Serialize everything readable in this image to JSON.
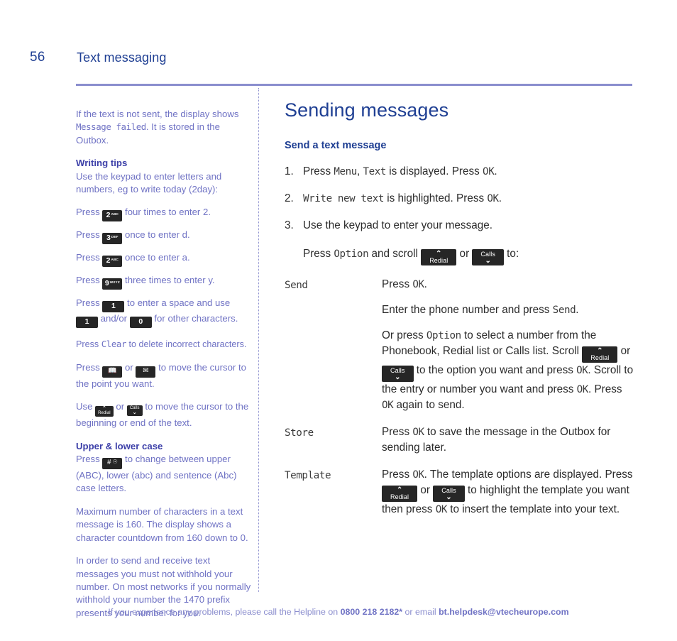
{
  "header": {
    "page_number": "56",
    "chapter_title": "Text messaging"
  },
  "left_column": {
    "intro": {
      "part1": "If the text is not sent, the display shows ",
      "lcd": "Message failed",
      "part2": ". It is stored in the Outbox."
    },
    "writing_tips": {
      "heading": "Writing tips",
      "lead": "Use the keypad to enter letters and numbers, eg to write today (2day):",
      "steps": [
        {
          "before": "Press ",
          "key": {
            "digit": "2",
            "letters": "ABC"
          },
          "after": " four times to enter 2."
        },
        {
          "before": "Press ",
          "key": {
            "digit": "3",
            "letters": "DEF"
          },
          "after": " once to enter d."
        },
        {
          "before": "Press ",
          "key": {
            "digit": "2",
            "letters": "ABC"
          },
          "after": " once to enter a."
        },
        {
          "before": "Press ",
          "key": {
            "digit": "9",
            "letters": "WXYZ"
          },
          "after": " three times to enter y."
        }
      ],
      "space_line": {
        "part1": "Press ",
        "key1": "1",
        "part2": " to enter a space and use ",
        "key2": "1",
        "part3": " and/or ",
        "key3": "0",
        "part4": " for other characters."
      },
      "clear_line": {
        "part1": "Press ",
        "lcd": "Clear",
        "part2": " to delete incorrect characters."
      },
      "cursor_line": {
        "part1": "Press ",
        "key_book": "book-key",
        "part2": " or ",
        "key_envelope": "envelope-key",
        "part3": " to move the cursor to the point you want."
      },
      "ends_line": {
        "part1": "Use ",
        "key_redial": {
          "arrow": "⌃",
          "label": "Redial"
        },
        "part2": " or ",
        "key_calls": {
          "arrow": "⌄",
          "label": "Calls"
        },
        "part3": " to move the cursor to the beginning or end of the text."
      }
    },
    "upper_lower": {
      "heading": "Upper & lower case",
      "line": {
        "part1": "Press ",
        "key_hash": {
          "hash": "#",
          "lock": "●"
        },
        "part2": " to change between upper (ABC), lower (abc) and sentence (Abc) case letters."
      }
    },
    "max_chars": "Maximum number of characters in a text message is 160. The display shows a character countdown from 160 down to 0.",
    "withhold": "In order to send and receive text messages you must not withhold your number. On most networks if you normally withhold your number the 1470 prefix presents your number for you."
  },
  "right_column": {
    "title": "Sending messages",
    "subtitle": "Send a text message",
    "steps": [
      {
        "number": "1.",
        "parts": [
          {
            "type": "text",
            "value": "Press "
          },
          {
            "type": "lcd",
            "value": "Menu"
          },
          {
            "type": "text",
            "value": ", "
          },
          {
            "type": "lcd",
            "value": "Text"
          },
          {
            "type": "text",
            "value": " is displayed. Press "
          },
          {
            "type": "lcd",
            "value": "OK"
          },
          {
            "type": "text",
            "value": "."
          }
        ]
      },
      {
        "number": "2.",
        "parts": [
          {
            "type": "lcd",
            "value": "Write new text"
          },
          {
            "type": "text",
            "value": " is highlighted. Press "
          },
          {
            "type": "lcd",
            "value": "OK"
          },
          {
            "type": "text",
            "value": "."
          }
        ]
      },
      {
        "number": "3.",
        "parts": [
          {
            "type": "text",
            "value": "Use the keypad to enter your message."
          }
        ]
      }
    ],
    "scroll_line": {
      "part1": "Press ",
      "lcd": "Option",
      "part2": " and scroll ",
      "key_redial": {
        "arrow": "⌃",
        "label": "Redial"
      },
      "part3": " or ",
      "key_calls": {
        "arrow": "⌄",
        "label": "Calls"
      },
      "part4": " to:"
    },
    "options": [
      {
        "term": "Send",
        "paragraphs": [
          {
            "part1": "Press ",
            "lcd1": "OK",
            "part2": "."
          },
          {
            "part1": "Enter the phone number and press ",
            "lcd1": "Send",
            "part2": "."
          }
        ],
        "long_paragraph": {
          "p1": "Or press ",
          "lcd1": "Option",
          "p2": " to select a number from the Phonebook, Redial list or Calls list. Scroll ",
          "key_redial": {
            "arrow": "⌃",
            "label": "Redial"
          },
          "p3": " or ",
          "key_calls": {
            "arrow": "⌄",
            "label": "Calls"
          },
          "p4": " to the option you want and press ",
          "lcd2": "OK",
          "p5": ". Scroll to the entry or number you want and press ",
          "lcd3": "OK",
          "p6": ". Press ",
          "lcd4": "OK",
          "p7": " again to send."
        }
      },
      {
        "term": "Store",
        "paragraphs": [
          {
            "part1": "Press ",
            "lcd1": "OK",
            "part2": " to save the message in the Outbox for sending later."
          }
        ]
      },
      {
        "term": "Template",
        "paragraphs": [],
        "template_paragraph": {
          "p1": "Press ",
          "lcd1": "OK",
          "p2": ". The template options are displayed. Press ",
          "key_redial": {
            "arrow": "⌃",
            "label": "Redial"
          },
          "p3": " or ",
          "key_calls": {
            "arrow": "⌄",
            "label": "Calls"
          },
          "p4": " to highlight the template you want then press ",
          "lcd2": "OK",
          "p5": " to insert the template into your text."
        }
      }
    ]
  },
  "footer": {
    "part1": "If you experience any problems, please call the Helpline on ",
    "phone": "0800 218 2182*",
    "part2": " or email ",
    "email": "bt.helpdesk@vtecheurope.com"
  },
  "colors": {
    "heading_blue": "#1f3f93",
    "left_text": "#6f72c4",
    "rule": "#8b8ece",
    "key_bg": "#262626",
    "body_text": "#2b2b2b"
  }
}
